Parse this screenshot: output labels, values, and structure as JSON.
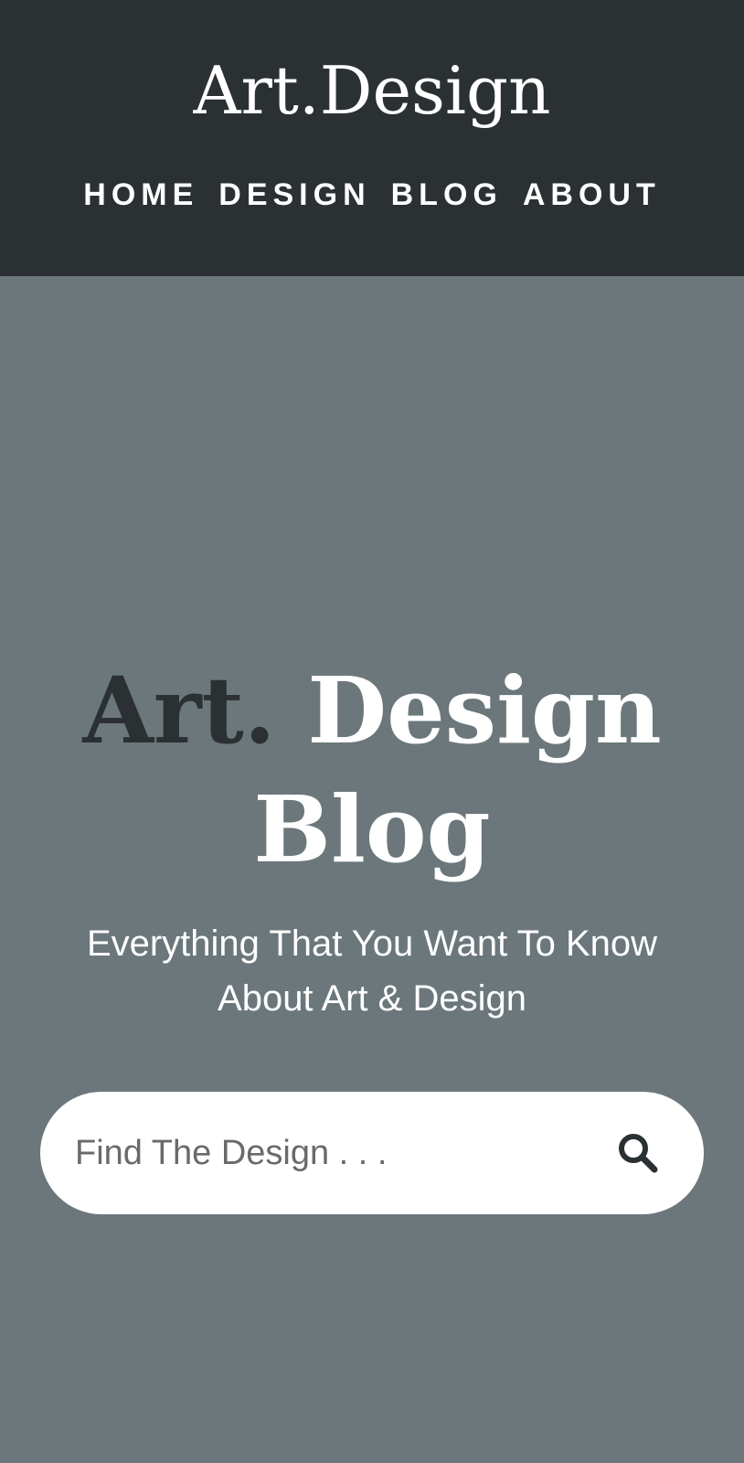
{
  "header": {
    "logo": "Art.Design",
    "nav": [
      {
        "label": "HOME"
      },
      {
        "label": "DESIGN"
      },
      {
        "label": "BLOG"
      },
      {
        "label": "ABOUT"
      }
    ]
  },
  "hero": {
    "title_dark": "Art.",
    "title_light_line1": "Design",
    "title_line2": "Blog",
    "subtitle": "Everything That You Want To Know About Art & Design"
  },
  "search": {
    "placeholder": "Find The Design . . .",
    "value": "",
    "icon": "search-icon"
  },
  "colors": {
    "header_bg": "#2b3033",
    "hero_bg": "#6b777b",
    "text_light": "#ffffff",
    "text_dark": "#2b3033"
  }
}
